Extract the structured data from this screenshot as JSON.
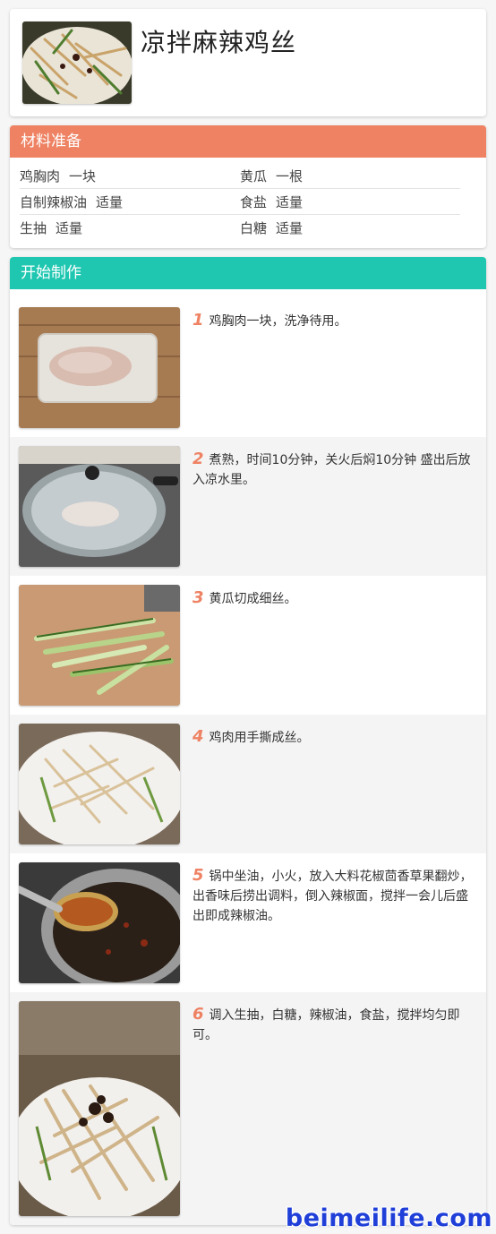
{
  "recipe": {
    "title": "凉拌麻辣鸡丝"
  },
  "ingredients": {
    "heading": "材料准备",
    "items": [
      {
        "name": "鸡胸肉",
        "amount": "一块"
      },
      {
        "name": "黄瓜",
        "amount": "一根"
      },
      {
        "name": "自制辣椒油",
        "amount": "适量"
      },
      {
        "name": "食盐",
        "amount": "适量"
      },
      {
        "name": "生抽",
        "amount": "适量"
      },
      {
        "name": "白糖",
        "amount": "适量"
      }
    ]
  },
  "steps": {
    "heading": "开始制作",
    "items": [
      {
        "num": "1",
        "text": "鸡胸肉一块，洗净待用。",
        "photo_icon": "chicken-breast-photo"
      },
      {
        "num": "2",
        "text": "煮熟，时间10分钟，关火后焖10分钟 盛出后放入凉水里。",
        "photo_icon": "pot-photo"
      },
      {
        "num": "3",
        "text": "黄瓜切成细丝。",
        "photo_icon": "cucumber-photo"
      },
      {
        "num": "4",
        "text": "鸡肉用手撕成丝。",
        "photo_icon": "shredded-chicken-photo"
      },
      {
        "num": "5",
        "text": "锅中坐油，小火，放入大料花椒茴香草果翻炒，出香味后捞出调料，倒入辣椒面，搅拌一会儿后盛出即成辣椒油。",
        "photo_icon": "chili-oil-photo"
      },
      {
        "num": "6",
        "text": "调入生抽，白糖，辣椒油，食盐，搅拌均匀即可。",
        "photo_icon": "finished-dish-photo"
      }
    ]
  },
  "watermark": "beimeilife.com",
  "colors": {
    "ingredients_bar": "#ee8263",
    "steps_bar": "#1fc7b1",
    "step_number": "#ee8263",
    "watermark": "#1f3fd8"
  }
}
